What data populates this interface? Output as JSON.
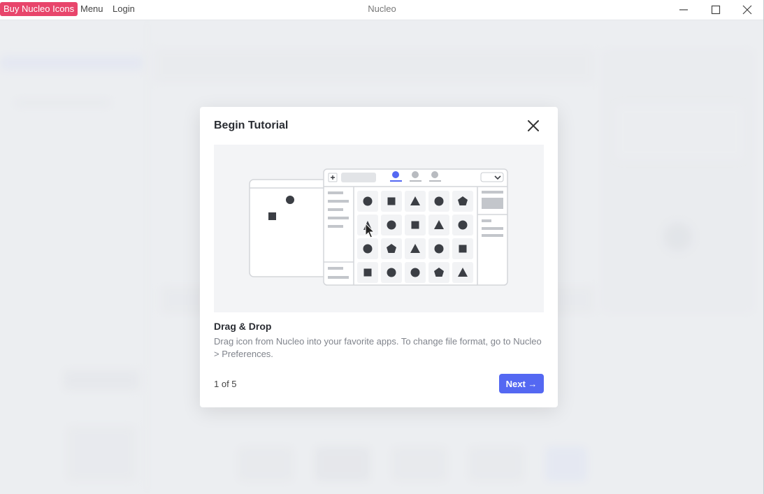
{
  "titlebar": {
    "buy_label": "Buy Nucleo Icons",
    "menu_label": "Menu",
    "login_label": "Login",
    "app_title": "Nucleo",
    "controls": [
      "minimize-icon",
      "maximize-icon",
      "close-icon"
    ]
  },
  "modal": {
    "title": "Begin Tutorial",
    "close_icon": "close-icon",
    "step_title": "Drag & Drop",
    "step_description": "Drag icon from Nucleo into your favorite apps. To change file format, go to Nucleo > Preferences.",
    "step_counter": "1 of 5",
    "next_label": "Next →"
  },
  "colors": {
    "brand_pink": "#e8456b",
    "accent_blue": "#5468f2",
    "icon_dark": "#3b3e44"
  }
}
